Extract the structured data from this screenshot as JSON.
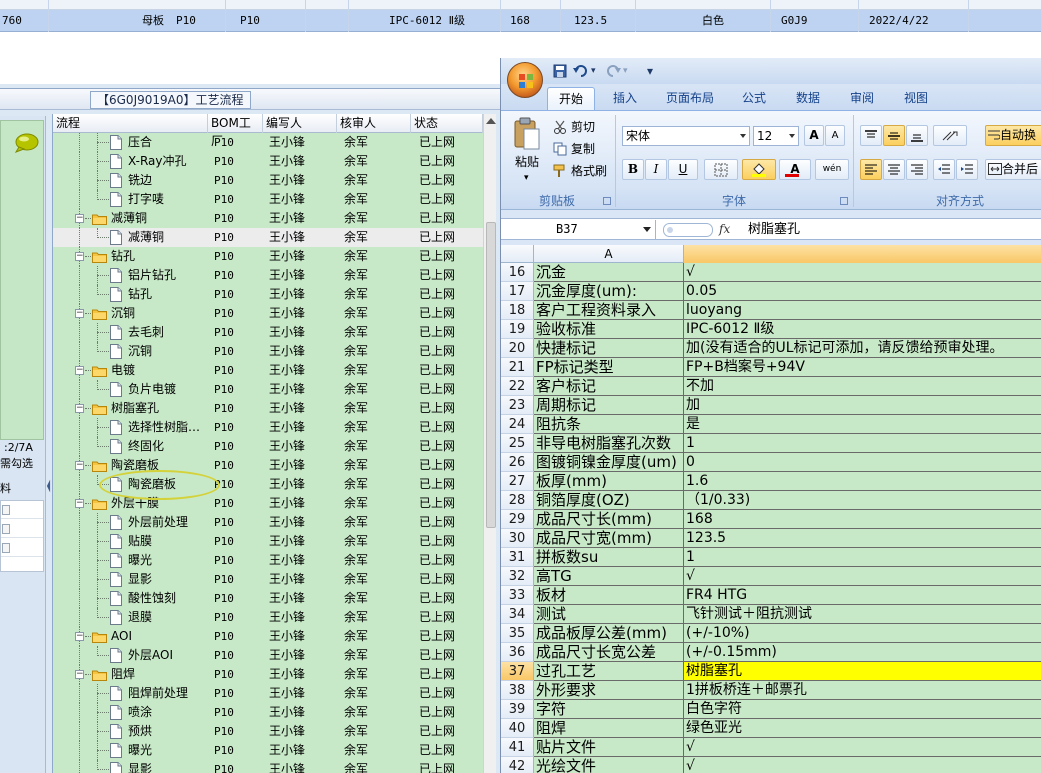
{
  "top_strip": {
    "cells": [
      "760",
      "母板",
      "P10",
      "P10",
      "IPC-6012 Ⅱ级",
      "168",
      "123.5",
      "白色",
      "G0J9",
      "2022/4/22"
    ]
  },
  "tree_panel": {
    "title": "【6G0J9019A0】工艺流程",
    "columns": [
      "流程",
      "BOM工厂",
      "编写人",
      "核审人",
      "状态"
    ],
    "rows": [
      {
        "level": 2,
        "type": "doc",
        "name": "压合",
        "bom": "P10",
        "author": "王小锋",
        "reviewer": "余军",
        "status": "已上网"
      },
      {
        "level": 2,
        "type": "doc",
        "name": "X-Ray冲孔",
        "bom": "P10",
        "author": "王小锋",
        "reviewer": "余军",
        "status": "已上网"
      },
      {
        "level": 2,
        "type": "doc",
        "name": "铣边",
        "bom": "P10",
        "author": "王小锋",
        "reviewer": "余军",
        "status": "已上网"
      },
      {
        "level": 2,
        "type": "doc",
        "name": "打字唛",
        "bom": "P10",
        "author": "王小锋",
        "reviewer": "余军",
        "status": "已上网"
      },
      {
        "level": 1,
        "type": "folder",
        "name": "减薄铜",
        "bom": "P10",
        "author": "王小锋",
        "reviewer": "余军",
        "status": "已上网"
      },
      {
        "level": 2,
        "type": "doc",
        "name": "减薄铜",
        "bom": "P10",
        "author": "王小锋",
        "reviewer": "余军",
        "status": "已上网",
        "selected": true
      },
      {
        "level": 1,
        "type": "folder",
        "name": "钻孔",
        "bom": "P10",
        "author": "王小锋",
        "reviewer": "余军",
        "status": "已上网"
      },
      {
        "level": 2,
        "type": "doc",
        "name": "铝片钻孔",
        "bom": "P10",
        "author": "王小锋",
        "reviewer": "余军",
        "status": "已上网"
      },
      {
        "level": 2,
        "type": "doc",
        "name": "钻孔",
        "bom": "P10",
        "author": "王小锋",
        "reviewer": "余军",
        "status": "已上网"
      },
      {
        "level": 1,
        "type": "folder",
        "name": "沉铜",
        "bom": "P10",
        "author": "王小锋",
        "reviewer": "余军",
        "status": "已上网"
      },
      {
        "level": 2,
        "type": "doc",
        "name": "去毛刺",
        "bom": "P10",
        "author": "王小锋",
        "reviewer": "余军",
        "status": "已上网"
      },
      {
        "level": 2,
        "type": "doc",
        "name": "沉铜",
        "bom": "P10",
        "author": "王小锋",
        "reviewer": "余军",
        "status": "已上网"
      },
      {
        "level": 1,
        "type": "folder",
        "name": "电镀",
        "bom": "P10",
        "author": "王小锋",
        "reviewer": "余军",
        "status": "已上网"
      },
      {
        "level": 2,
        "type": "doc",
        "name": "负片电镀",
        "bom": "P10",
        "author": "王小锋",
        "reviewer": "余军",
        "status": "已上网"
      },
      {
        "level": 1,
        "type": "folder",
        "name": "树脂塞孔",
        "bom": "P10",
        "author": "王小锋",
        "reviewer": "余军",
        "status": "已上网"
      },
      {
        "level": 2,
        "type": "doc",
        "name": "选择性树脂…",
        "bom": "P10",
        "author": "王小锋",
        "reviewer": "余军",
        "status": "已上网"
      },
      {
        "level": 2,
        "type": "doc",
        "name": "终固化",
        "bom": "P10",
        "author": "王小锋",
        "reviewer": "余军",
        "status": "已上网"
      },
      {
        "level": 1,
        "type": "folder",
        "name": "陶瓷磨板",
        "bom": "P10",
        "author": "王小锋",
        "reviewer": "余军",
        "status": "已上网"
      },
      {
        "level": 2,
        "type": "doc",
        "name": "陶瓷磨板",
        "bom": "P10",
        "author": "王小锋",
        "reviewer": "余军",
        "status": "已上网"
      },
      {
        "level": 1,
        "type": "folder",
        "name": "外层干膜",
        "bom": "P10",
        "author": "王小锋",
        "reviewer": "余军",
        "status": "已上网"
      },
      {
        "level": 2,
        "type": "doc",
        "name": "外层前处理",
        "bom": "P10",
        "author": "王小锋",
        "reviewer": "余军",
        "status": "已上网"
      },
      {
        "level": 2,
        "type": "doc",
        "name": "贴膜",
        "bom": "P10",
        "author": "王小锋",
        "reviewer": "余军",
        "status": "已上网"
      },
      {
        "level": 2,
        "type": "doc",
        "name": "曝光",
        "bom": "P10",
        "author": "王小锋",
        "reviewer": "余军",
        "status": "已上网"
      },
      {
        "level": 2,
        "type": "doc",
        "name": "显影",
        "bom": "P10",
        "author": "王小锋",
        "reviewer": "余军",
        "status": "已上网"
      },
      {
        "level": 2,
        "type": "doc",
        "name": "酸性蚀刻",
        "bom": "P10",
        "author": "王小锋",
        "reviewer": "余军",
        "status": "已上网"
      },
      {
        "level": 2,
        "type": "doc",
        "name": "退膜",
        "bom": "P10",
        "author": "王小锋",
        "reviewer": "余军",
        "status": "已上网"
      },
      {
        "level": 1,
        "type": "folder",
        "name": "AOI",
        "bom": "P10",
        "author": "王小锋",
        "reviewer": "余军",
        "status": "已上网"
      },
      {
        "level": 2,
        "type": "doc",
        "name": "外层AOI",
        "bom": "P10",
        "author": "王小锋",
        "reviewer": "余军",
        "status": "已上网"
      },
      {
        "level": 1,
        "type": "folder",
        "name": "阻焊",
        "bom": "P10",
        "author": "王小锋",
        "reviewer": "余军",
        "status": "已上网"
      },
      {
        "level": 2,
        "type": "doc",
        "name": "阻焊前处理",
        "bom": "P10",
        "author": "王小锋",
        "reviewer": "余军",
        "status": "已上网"
      },
      {
        "level": 2,
        "type": "doc",
        "name": "喷涂",
        "bom": "P10",
        "author": "王小锋",
        "reviewer": "余军",
        "status": "已上网"
      },
      {
        "level": 2,
        "type": "doc",
        "name": "预烘",
        "bom": "P10",
        "author": "王小锋",
        "reviewer": "余军",
        "status": "已上网"
      },
      {
        "level": 2,
        "type": "doc",
        "name": "曝光",
        "bom": "P10",
        "author": "王小锋",
        "reviewer": "余军",
        "status": "已上网"
      },
      {
        "level": 2,
        "type": "doc",
        "name": "显影",
        "bom": "P10",
        "author": "王小锋",
        "reviewer": "余军",
        "status": "已上网"
      }
    ]
  },
  "side_panel": {
    "label_count": ":2/7A",
    "label_select": "需勾选",
    "label_material": "料"
  },
  "excel": {
    "qat_dropdown": "▾",
    "tabs": [
      "开始",
      "插入",
      "页面布局",
      "公式",
      "数据",
      "审阅",
      "视图"
    ],
    "active_tab": "开始",
    "clipboard": {
      "paste": "粘贴",
      "cut": "剪切",
      "copy": "复制",
      "format_painter": "格式刷",
      "group": "剪贴板"
    },
    "font": {
      "name": "宋体",
      "size": "12",
      "bold": "B",
      "italic": "I",
      "underline": "U",
      "group": "字体",
      "grow": "A",
      "shrink": "A",
      "color_letter": "A",
      "phonetic": "wén"
    },
    "alignment": {
      "wrap_text": "自动换",
      "merge": "合并后",
      "group": "对齐方式"
    },
    "name_box": "B37",
    "fx": "fx",
    "formula_value": "树脂塞孔",
    "column_a_header": "A",
    "rows": [
      {
        "n": "16",
        "a": "沉金",
        "b": "√"
      },
      {
        "n": "17",
        "a": "沉金厚度(um):",
        "b": "0.05"
      },
      {
        "n": "18",
        "a": "客户工程资料录入",
        "b": "luoyang"
      },
      {
        "n": "19",
        "a": "验收标准",
        "b": "IPC-6012 Ⅱ级"
      },
      {
        "n": "20",
        "a": "快捷标记",
        "b": "加(没有适合的UL标记可添加，请反馈给预审处理。"
      },
      {
        "n": "21",
        "a": "FP标记类型",
        "b": "FP+B档案号+94V"
      },
      {
        "n": "22",
        "a": "客户标记",
        "b": "不加"
      },
      {
        "n": "23",
        "a": "周期标记",
        "b": "加"
      },
      {
        "n": "24",
        "a": "阻抗条",
        "b": "是"
      },
      {
        "n": "25",
        "a": "非导电树脂塞孔次数",
        "b": "1"
      },
      {
        "n": "26",
        "a": "图镀铜镍金厚度(um)",
        "b": "0"
      },
      {
        "n": "27",
        "a": "板厚(mm)",
        "b": "1.6"
      },
      {
        "n": "28",
        "a": "铜箔厚度(OZ)",
        "b": "（1/0.33)"
      },
      {
        "n": "29",
        "a": "成品尺寸长(mm)",
        "b": "168"
      },
      {
        "n": "30",
        "a": "成品尺寸宽(mm)",
        "b": "123.5"
      },
      {
        "n": "31",
        "a": "拼板数su",
        "b": "1"
      },
      {
        "n": "32",
        "a": "高TG",
        "b": "√"
      },
      {
        "n": "33",
        "a": "板材",
        "b": "FR4 HTG"
      },
      {
        "n": "34",
        "a": "测试",
        "b": "飞针测试＋阻抗测试"
      },
      {
        "n": "35",
        "a": "成品板厚公差(mm)",
        "b": "(+/-10%)"
      },
      {
        "n": "36",
        "a": "成品尺寸长宽公差",
        "b": "(+/-0.15mm)"
      },
      {
        "n": "37",
        "a": "过孔工艺",
        "b": "树脂塞孔",
        "active": true
      },
      {
        "n": "38",
        "a": "外形要求",
        "b": "1拼板桥连＋邮票孔"
      },
      {
        "n": "39",
        "a": "字符",
        "b": "白色字符"
      },
      {
        "n": "40",
        "a": "阻焊",
        "b": "绿色亚光"
      },
      {
        "n": "41",
        "a": "贴片文件",
        "b": "√"
      },
      {
        "n": "42",
        "a": "光绘文件",
        "b": "√"
      }
    ]
  },
  "colors": {
    "grid_green": "#c8e9c8",
    "selected_cell": "#ffff00",
    "ellipse": "#d4d23a"
  }
}
